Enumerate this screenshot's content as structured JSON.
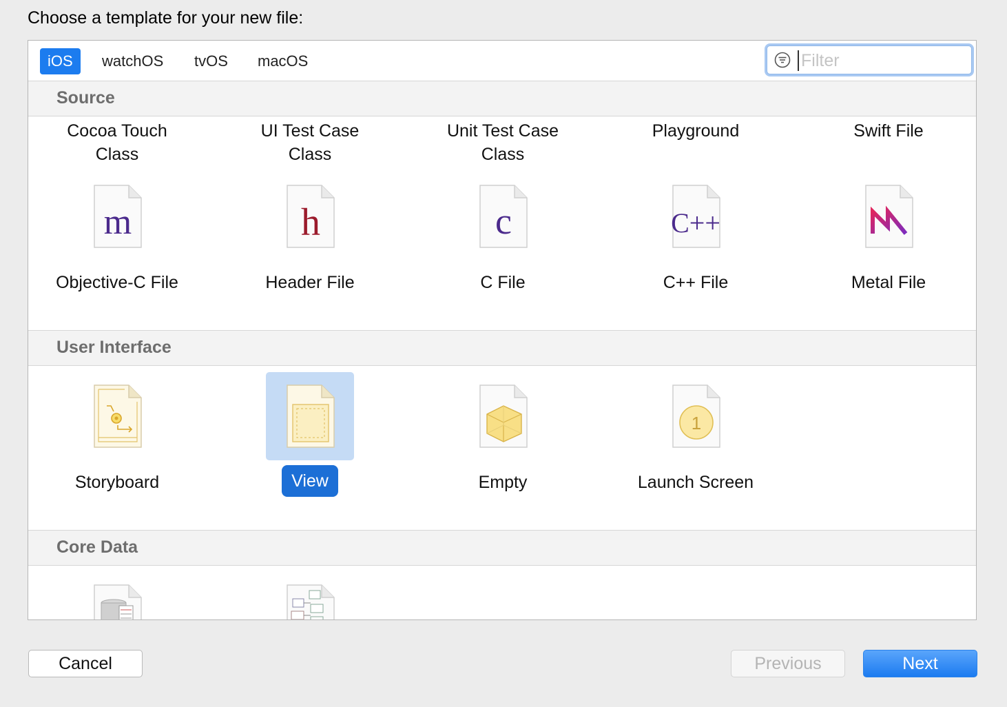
{
  "dialog": {
    "heading": "Choose a template for your new file:"
  },
  "platform_tabs": [
    {
      "label": "iOS",
      "selected": true
    },
    {
      "label": "watchOS",
      "selected": false
    },
    {
      "label": "tvOS",
      "selected": false
    },
    {
      "label": "macOS",
      "selected": false
    }
  ],
  "filter": {
    "placeholder": "Filter",
    "value": "",
    "icon": "filter-icon"
  },
  "sections": [
    {
      "title": "Source",
      "items": [
        {
          "name": "Cocoa Touch\nClass",
          "icon": "swift-class-icon"
        },
        {
          "name": "UI Test Case\nClass",
          "icon": "test-class-icon"
        },
        {
          "name": "Unit Test Case\nClass",
          "icon": "test-class-icon"
        },
        {
          "name": "Playground",
          "icon": "playground-icon"
        },
        {
          "name": "Swift File",
          "icon": "swift-file-icon"
        },
        {
          "name": "Objective-C File",
          "icon": "objc-file-icon",
          "glyph": "m",
          "glyph_color": "#4b2a8c"
        },
        {
          "name": "Header File",
          "icon": "header-file-icon",
          "glyph": "h",
          "glyph_color": "#9b1b2c"
        },
        {
          "name": "C File",
          "icon": "c-file-icon",
          "glyph": "c",
          "glyph_color": "#4b2a8c"
        },
        {
          "name": "C++ File",
          "icon": "cpp-file-icon",
          "glyph": "C++",
          "glyph_color": "#4b2a8c"
        },
        {
          "name": "Metal File",
          "icon": "metal-file-icon"
        }
      ]
    },
    {
      "title": "User Interface",
      "items": [
        {
          "name": "Storyboard",
          "icon": "storyboard-file-icon"
        },
        {
          "name": "View",
          "icon": "view-file-icon",
          "selected": true
        },
        {
          "name": "Empty",
          "icon": "empty-file-icon"
        },
        {
          "name": "Launch Screen",
          "icon": "launch-screen-file-icon",
          "badge": "1"
        }
      ]
    },
    {
      "title": "Core Data",
      "items": [
        {
          "name": "",
          "icon": "data-model-icon"
        },
        {
          "name": "",
          "icon": "mapping-model-icon"
        }
      ]
    }
  ],
  "buttons": {
    "cancel": "Cancel",
    "previous": "Previous",
    "next": "Next"
  },
  "colors": {
    "accent": "#1c7cef",
    "selection_bg": "#c5dbf5",
    "selection_label": "#1c6fd6",
    "section_header_text": "#6d6d6d"
  }
}
